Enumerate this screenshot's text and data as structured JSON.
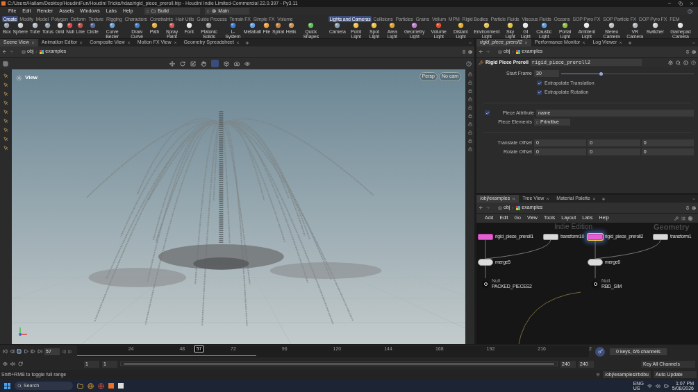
{
  "window": {
    "title": "C:/Users/Hallam/Desktop/HoudiniFun/Houdini Tricks/hdas/rigid_piece_preroll.hip - Houdini Indie Limited-Commercial 22.0.397 - Py3.11"
  },
  "menus": [
    "File",
    "Edit",
    "Render",
    "Assets",
    "Windows",
    "Labs",
    "Help"
  ],
  "desktop": "Build",
  "workspace": "Main",
  "shelf_left": {
    "tabs": [
      {
        "label": "Create",
        "selected": true
      },
      {
        "label": "Modify",
        "selected": false
      },
      {
        "label": "Model",
        "selected": false
      },
      {
        "label": "Polygon",
        "selected": false
      },
      {
        "label": "Deform",
        "selected": false
      },
      {
        "label": "Texture",
        "selected": false
      },
      {
        "label": "Rigging",
        "selected": false
      },
      {
        "label": "Characters",
        "selected": false
      },
      {
        "label": "Constraints",
        "selected": false
      },
      {
        "label": "Hair Utils",
        "selected": false
      },
      {
        "label": "Guide Process",
        "selected": false
      },
      {
        "label": "Terrain FX",
        "selected": false
      },
      {
        "label": "Simple FX",
        "selected": false
      },
      {
        "label": "Volume",
        "selected": false
      }
    ],
    "tools": [
      "Box",
      "Sphere",
      "Tube",
      "Torus",
      "Grid",
      "Null",
      "Line",
      "Circle",
      "Curve Bezier",
      "Draw Curve",
      "Path",
      "Spray Paint",
      "Font",
      "Platonic Solids",
      "L-System",
      "Metaball",
      "File",
      "Spiral",
      "Helix",
      "Quick Shapes"
    ]
  },
  "shelf_right": {
    "tabs": [
      {
        "label": "Lights and Cameras",
        "selected": true
      },
      {
        "label": "Collisions",
        "selected": false
      },
      {
        "label": "Particles",
        "selected": false
      },
      {
        "label": "Grains",
        "selected": false
      },
      {
        "label": "Vellum",
        "selected": false
      },
      {
        "label": "MPM",
        "selected": false
      },
      {
        "label": "Rigid Bodies",
        "selected": false
      },
      {
        "label": "Particle Fluids",
        "selected": false
      },
      {
        "label": "Viscous Fluids",
        "selected": false
      },
      {
        "label": "Oceans",
        "selected": false
      },
      {
        "label": "SOP Pyro FX",
        "selected": false
      },
      {
        "label": "SOP Particle FX",
        "selected": false
      },
      {
        "label": "DOP Pyro FX",
        "selected": false
      },
      {
        "label": "FEM",
        "selected": false
      }
    ],
    "tools": [
      "Camera",
      "Point Light",
      "Spot Light",
      "Area Light",
      "Geometry Light",
      "Volume Light",
      "Distant Light",
      "Environment Light",
      "Sky Light",
      "GI Light",
      "Caustic Light",
      "Portal Light",
      "Ambient Light",
      "Stereo Camera",
      "VR Camera",
      "Switcher",
      "Gamepad Camera"
    ]
  },
  "scene_view": {
    "tabs": [
      {
        "label": "Scene View",
        "selected": true
      },
      {
        "label": "Animation Editor",
        "selected": false
      },
      {
        "label": "Composite View",
        "selected": false
      },
      {
        "label": "Motion FX View",
        "selected": false
      },
      {
        "label": "Geometry Spreadsheet",
        "selected": false
      }
    ],
    "path": [
      "obj",
      "examples"
    ],
    "viewport": {
      "title": "View",
      "camera": [
        "Persp",
        "No cam"
      ]
    }
  },
  "parameters": {
    "tabs": [
      {
        "label": "rigid_piece_preroll2",
        "selected": true
      },
      {
        "label": "Performance Monitor",
        "selected": false
      },
      {
        "label": "Log Viewer",
        "selected": false
      }
    ],
    "path": [
      "obj",
      "examples"
    ],
    "node_type": "Rigid Piece Preroll",
    "node_name": "rigid_piece_preroll2",
    "start_frame": {
      "label": "Start Frame",
      "value": "30",
      "level": 0.3
    },
    "toggles": [
      {
        "label": "Extrapolate Translation",
        "checked": true
      },
      {
        "label": "Extrapolate Rotation",
        "checked": true
      }
    ],
    "piece_attribute": {
      "label": "Piece Attribute",
      "checked": true,
      "value": "name"
    },
    "piece_elements": {
      "label": "Piece Elements",
      "value": "Primitive"
    },
    "offsets": [
      {
        "label": "Translate Offset",
        "values": [
          "0",
          "0",
          "0"
        ]
      },
      {
        "label": "Rotate Offset",
        "values": [
          "0",
          "0",
          "0"
        ]
      }
    ]
  },
  "network": {
    "tabs": [
      {
        "label": "/obj/examples",
        "selected": true
      },
      {
        "label": "Tree View",
        "selected": false
      },
      {
        "label": "Material Palette",
        "selected": false
      }
    ],
    "path": [
      "obj",
      "examples"
    ],
    "menus": [
      "Add",
      "Edit",
      "Go",
      "View",
      "Tools",
      "Layout",
      "Labs",
      "Help"
    ],
    "watermarks": [
      "Indie Edition",
      "Geometry"
    ],
    "nodes": [
      {
        "kind": "preroll",
        "name": "rigid_piece_preroll1",
        "selected": false
      },
      {
        "kind": "transform",
        "name": "transform10",
        "selected": false
      },
      {
        "kind": "preroll",
        "name": "rigid_piece_preroll2",
        "selected": true
      },
      {
        "kind": "transform",
        "name": "transform1",
        "selected": false
      },
      {
        "kind": "merge",
        "name": "merge5",
        "selected": false
      },
      {
        "kind": "merge",
        "name": "merge6",
        "selected": false
      },
      {
        "kind": "null",
        "type": "Null",
        "name": "PACKED_PIECES2",
        "selected": false
      },
      {
        "kind": "null",
        "type": "Null",
        "name": "RBD_SIM",
        "selected": false
      }
    ]
  },
  "timeline": {
    "frame": "57",
    "playhead": {
      "label": "57",
      "level": 0.237
    },
    "ticks": [
      "24",
      "48",
      "72",
      "96",
      "120",
      "144",
      "168",
      "192",
      "216",
      "2"
    ],
    "range_start": [
      "1",
      "1"
    ],
    "range_bar": {
      "level": 1
    },
    "range_end": [
      "240",
      "240"
    ],
    "keys": "0 keys, 6/6 channels",
    "key_all": "Key All Channels"
  },
  "status_bar": {
    "message": "Shift+RMB to toggle full range",
    "path": "/obj/examples/rbdbu",
    "update_mode": "Auto Update"
  },
  "taskbar": {
    "search": "Search",
    "language": [
      "ENG",
      "US"
    ],
    "time": "1:07 PM",
    "date": "5/08/2026"
  }
}
